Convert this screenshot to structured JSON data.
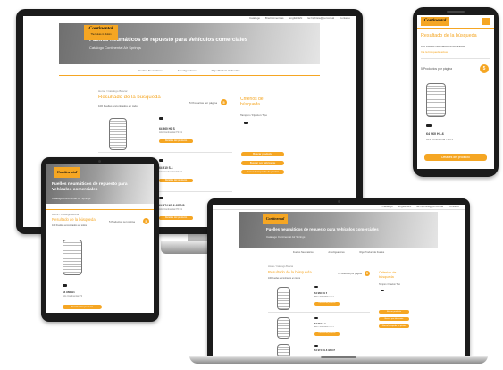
{
  "brand": {
    "name": "Continental",
    "tagline": "The Future in Motion",
    "accent_color": "#f5a623",
    "bezel_color": "#1b1b1b"
  },
  "topbar": {
    "links": [
      "Catalogo",
      "Brazil Americas",
      "English EN",
      "Iar.hightsia@porcoreal",
      "Contacto"
    ]
  },
  "hero": {
    "title": "Fuelles neumáticos de repuesto para Vehículos comerciales",
    "subtitle": "Catalogo Continental Air Springs"
  },
  "nav": {
    "items": [
      "Fuelles Neumaticos",
      "Amortiguadores",
      "Rigo Product de Fuelles"
    ]
  },
  "results": {
    "breadcrumb": "Home / Catalogo Buscar",
    "title": "Resultado de la búsqueda",
    "found": "100 Fuelles encontrados en todos",
    "count_label": "5 Productos por página",
    "filter_title": "Criterios de búsqueda",
    "filter_value": "Tampon / Fijacion Tipo",
    "products": [
      {
        "code": "64 960 H1 S",
        "detail": "Airs Continental 73 C1",
        "action": "Detalles del producto"
      },
      {
        "code": "64 910 S-1",
        "detail": "Airs Continental 74 C1",
        "action": "Detalles del producto"
      },
      {
        "code": "64 974 N1-6 4850 P",
        "detail": "Airs Continental 76 C1",
        "action": "Detalles del producto"
      }
    ],
    "filter_buttons": [
      "Buscar producto",
      "Buscar por fabricante",
      "Nueva busqueda de piezas"
    ]
  },
  "phone": {
    "title": "Resultado de la búsqueda",
    "found": "100 Fuelles neumáticos encontrados",
    "filter_link": "Ir a la búsqueda actual",
    "count_label": "5 Productos por página",
    "badge": "5",
    "product_code": "64 960 H1-6",
    "product_detail": "Airs Continental 74 C1",
    "action": "Detalles del producto"
  },
  "tablet": {
    "count_label": "5 Productos por página",
    "product_code": "64 960 H1",
    "product_detail": "Airs Continental 73"
  }
}
